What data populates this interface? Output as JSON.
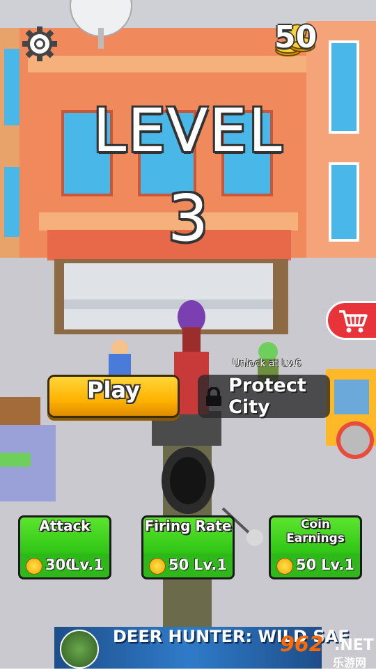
{
  "hud": {
    "coin_count": "50",
    "level_label": "LEVEL",
    "level_number": "3"
  },
  "actions": {
    "play_label": "Play",
    "protect_label": "Protect City",
    "protect_unlock_note": "Unlock at Lv.6"
  },
  "upgrades": [
    {
      "title": "Attack",
      "cost": "300",
      "level": "Lv.1"
    },
    {
      "title": "Firing Rate",
      "cost": "50",
      "level": "Lv.1"
    },
    {
      "title": "Coin Earnings",
      "cost": "50",
      "level": "Lv.1"
    }
  ],
  "ad": {
    "text": "DEER HUNTER: WILD SAF"
  },
  "watermark": {
    "num": "962",
    "net": ".NET",
    "cn": "乐游网"
  },
  "icons": {
    "settings": "gear-icon",
    "currency": "coin-stack-icon",
    "shop": "shopping-cart-icon",
    "locked": "lock-icon",
    "cost": "coin-icon"
  },
  "colors": {
    "play_button": "#ffb300",
    "upgrade_card": "#2fc415",
    "shop_button": "#e8333b",
    "locked_button": "#282828"
  }
}
